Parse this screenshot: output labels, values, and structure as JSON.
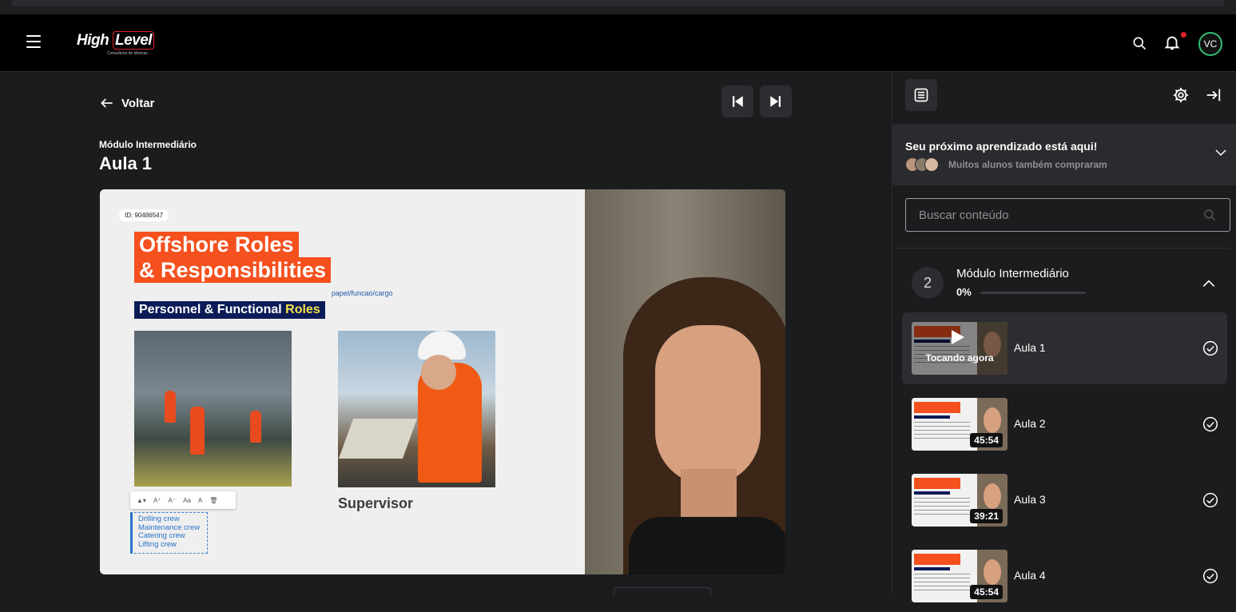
{
  "header": {
    "logo_text": "High Level",
    "logo_subtitle": "Consultoria de idiomas",
    "avatar_initials": "VC",
    "notification_dot_color": "#e0222a"
  },
  "main": {
    "back_label": "Voltar",
    "breadcrumb": "Módulo Intermediário",
    "lesson_title": "Aula 1",
    "prev_icon": "skip-previous-icon",
    "next_icon": "skip-next-icon"
  },
  "video": {
    "slide": {
      "id_label": "ID: 90486547",
      "title_line1": "Offshore Roles",
      "title_line2": "& Responsibilities",
      "annotation": "papel/funcao/cargo",
      "band_part1": "Personnel & Functional",
      "band_part2": "Roles",
      "list": [
        "Drilling crew",
        "Maintenance crew",
        "Catering crew",
        "Lifting crew"
      ],
      "caption": "Supervisor"
    }
  },
  "sidebar": {
    "promo": {
      "title": "Seu próximo aprendizado está aqui!",
      "subtitle": "Muitos alunos também compraram"
    },
    "search_placeholder": "Buscar conteúdo",
    "module": {
      "number": "2",
      "title": "Módulo Intermediário",
      "progress_label": "0%",
      "progress": 0
    },
    "lessons": [
      {
        "name": "Aula 1",
        "status": "Tocando agora",
        "active": true
      },
      {
        "name": "Aula 2",
        "duration": "45:54"
      },
      {
        "name": "Aula 3",
        "duration": "39:21"
      },
      {
        "name": "Aula 4",
        "duration": "45:54"
      }
    ]
  },
  "colors": {
    "accent_green": "#2fbf71",
    "slide_orange": "#f4511e",
    "slide_navy": "#0b1b57"
  }
}
